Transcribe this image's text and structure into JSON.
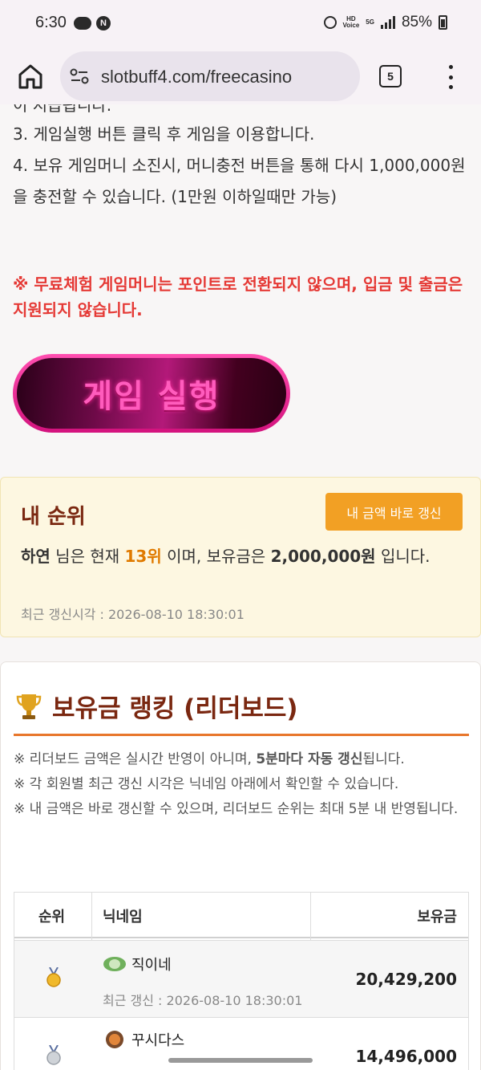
{
  "status_bar": {
    "time": "6:30",
    "notification_icons": [
      "cloud-icon",
      "n-app-icon"
    ],
    "hd_voice": "HD Voice",
    "network": "5G",
    "battery": "85%"
  },
  "browser": {
    "url": "slotbuff4.com/freecasino",
    "tab_count": "5"
  },
  "instructions": {
    "partial_line": "이 지급됩니다.",
    "step3": "3. 게임실행 버튼 클릭 후 게임을 이용합니다.",
    "step4": "4. 보유 게임머니 소진시, 머니충전 버튼을 통해 다시 1,000,000원을 충전할 수 있습니다. (1만원 이하일때만 가능)",
    "warning": "※ 무료체험 게임머니는 포인트로 전환되지 않으며, 입금 및 출금은 지원되지 않습니다."
  },
  "game_button": {
    "label": "게임 실행"
  },
  "my_rank": {
    "title": "내 순위",
    "refresh_button": "내 금액 바로 갱신",
    "nickname": "하연",
    "text_1": " 님은 현재 ",
    "rank": "13위",
    "text_2": " 이며, 보유금은 ",
    "balance": "2,000,000원",
    "text_3": " 입니다.",
    "updated": "최근 갱신시각 : 2026-08-10 18:30:01"
  },
  "leaderboard": {
    "title": "보유금 랭킹 (리더보드)",
    "notes": [
      {
        "pre": "※ 리더보드 금액은 실시간 반영이 아니며, ",
        "bold": "5분마다 자동 갱신",
        "post": "됩니다."
      },
      {
        "pre": "※ 각 회원별 최근 갱신 시각은 닉네임 아래에서 확인할 수 있습니다.",
        "bold": "",
        "post": ""
      },
      {
        "pre": "※ 내 금액은 바로 갱신할 수 있으며, 리더보드 순위는 최대 5분 내 반영됩니다.",
        "bold": "",
        "post": ""
      }
    ],
    "columns": [
      "순위",
      "닉네임",
      "보유금"
    ],
    "rows": [
      {
        "rank_icon": "gold-medal-icon",
        "nick_icon": "level-badge-icon",
        "nickname": "직이네",
        "updated": "최근 갱신 : 2026-08-10 18:30:01",
        "amount": "20,429,200"
      },
      {
        "rank_icon": "silver-medal-icon",
        "nick_icon": "level-6-badge-icon",
        "nickname": "꾸시다스",
        "updated": "",
        "amount": "14,496,000"
      }
    ]
  },
  "colors": {
    "warning": "#e53935",
    "title_brown": "#7a2710",
    "orange": "#f2a024",
    "rank_highlight": "#e07a00",
    "accent_rule": "#e8772c",
    "game_pink": "#ff5cbd"
  }
}
